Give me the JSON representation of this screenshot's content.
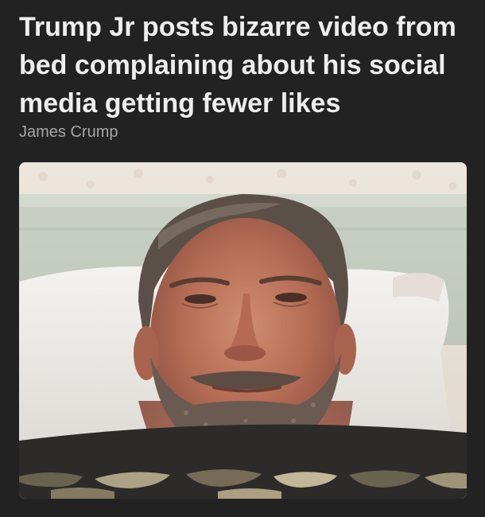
{
  "article": {
    "headline": "Trump Jr posts bizarre video from bed complaining about his social media getting fewer likes",
    "author": "James Crump"
  },
  "media": {
    "type": "video-still",
    "subject": "man lying in bed looking at camera"
  },
  "colors": {
    "background": "#222222",
    "headline": "#eeeeee",
    "author": "#a6a6a6"
  }
}
